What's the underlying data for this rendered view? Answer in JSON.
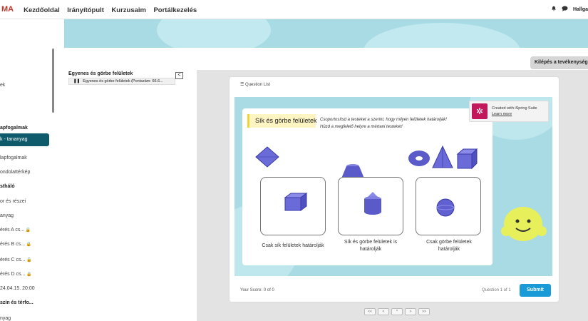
{
  "topbar": {
    "brand": "MA",
    "nav": [
      "Kezdőoldal",
      "Irányítópult",
      "Kurzusaim",
      "Portálkezelés"
    ],
    "user_label": "Hallga"
  },
  "sidebar": {
    "items": [
      {
        "label": "ek",
        "kind": "plain"
      },
      {
        "label": "apfogalmak",
        "kind": "bold"
      },
      {
        "label": "k - tananyag",
        "kind": "active"
      },
      {
        "label": "lapfogalmak",
        "kind": "plain"
      },
      {
        "label": "ondolattérkép",
        "kind": "plain"
      },
      {
        "label": "stháló",
        "kind": "bold"
      },
      {
        "label": "or és részei",
        "kind": "plain"
      },
      {
        "label": "anyag",
        "kind": "plain"
      },
      {
        "label": "érés A cs...",
        "kind": "locked"
      },
      {
        "label": "érés B cs...",
        "kind": "locked"
      },
      {
        "label": "érés C cs...",
        "kind": "locked"
      },
      {
        "label": "érés D cs...",
        "kind": "locked"
      },
      {
        "label": "24.04.15. 20:00",
        "kind": "plain"
      },
      {
        "label": "szín és térfo...",
        "kind": "bold"
      },
      {
        "label": "nyag",
        "kind": "plain"
      }
    ]
  },
  "exit_button": "Kilépés a tevékenységből",
  "course": {
    "title": "Egyenes és görbe felületek",
    "subtitle": "Egyenes és görbe felületek (Pontszám: 66.6...",
    "collapse": "<"
  },
  "player": {
    "question_list": "Question List",
    "slide_title": "Sík és görbe felületek",
    "instruction_line1": "Csoportosítsd a testeket a szerint, hogy milyen felületek határolják!",
    "instruction_line2": "Húzd a megfelelő helyre a mértani testeket!",
    "ispring_line1": "Created with iSpring Suite",
    "ispring_line2": "Learn more",
    "drop_labels": [
      "Csak sík felületek határolják",
      "Sík és görbe felületek is határolják",
      "Csak görbe felületek határolják"
    ],
    "score": "Your Score: 0 of 0",
    "question_num": "Question 1 of 1",
    "submit": "Submit",
    "nav_buttons": [
      "<<",
      "<",
      "^",
      ">",
      ">>"
    ]
  },
  "colors": {
    "accent": "#0f5b6b",
    "shape": "#6a6ad8",
    "slide_bg": "#a9dbe5",
    "submit": "#1a9ad6"
  }
}
